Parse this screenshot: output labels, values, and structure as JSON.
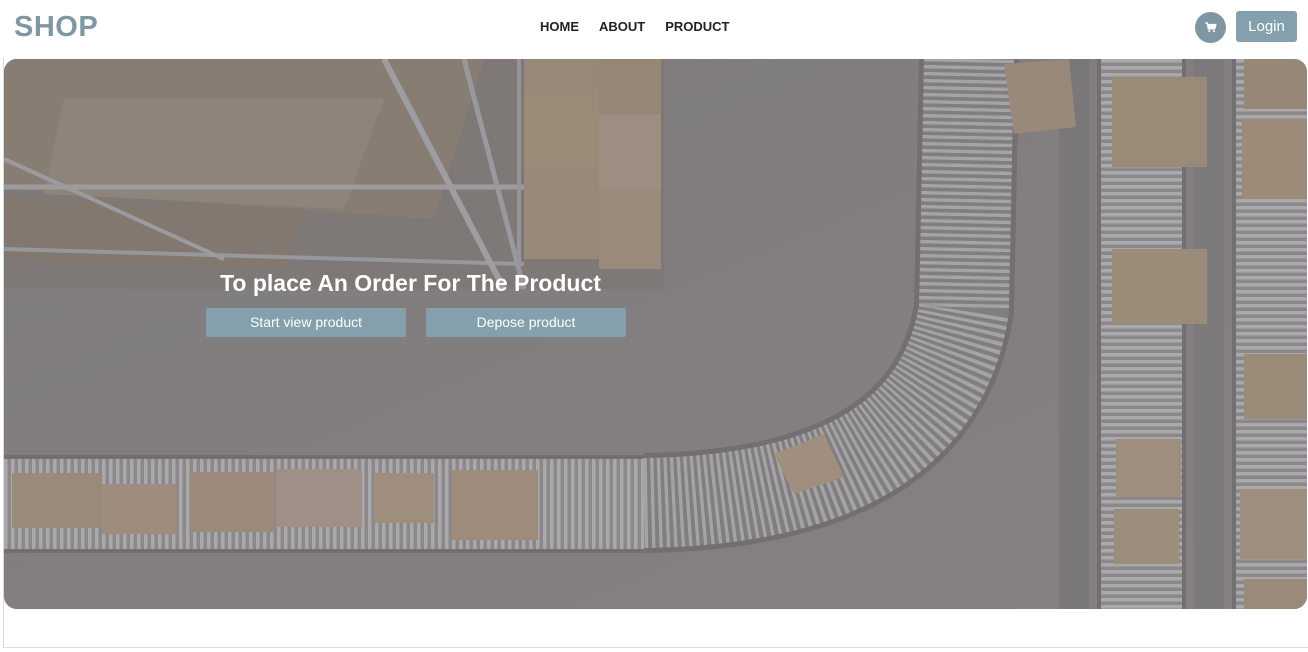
{
  "header": {
    "logo": "SHOP",
    "nav": [
      {
        "label": "HOME"
      },
      {
        "label": "ABOUT"
      },
      {
        "label": "PRODUCT"
      }
    ],
    "cart_icon": "cart-icon",
    "login_label": "Login"
  },
  "hero": {
    "background_image": "warehouse conveyor belts with cardboard boxes (aerial view)",
    "title": "To place An Order For The Product",
    "buttons": [
      {
        "label": "Start view product"
      },
      {
        "label": "Depose product"
      }
    ]
  },
  "colors": {
    "brand": "#7f97a3",
    "button": "#84a0ad",
    "nav_text": "#222222",
    "white": "#ffffff"
  }
}
